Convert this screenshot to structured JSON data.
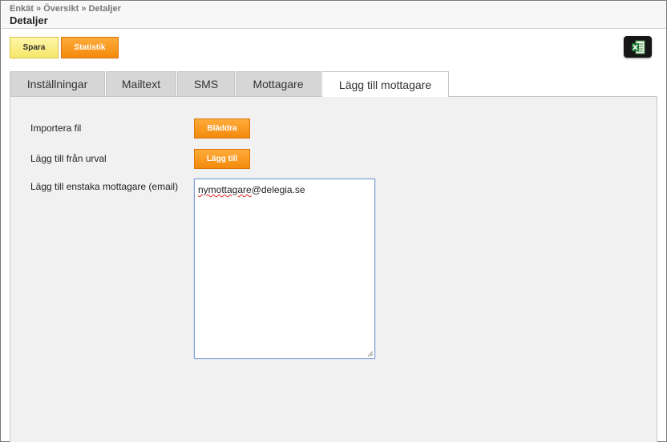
{
  "breadcrumb": {
    "items": [
      "Enkät",
      "Översikt",
      "Detaljer"
    ],
    "separator": "»"
  },
  "header": {
    "title": "Detaljer"
  },
  "toolbar": {
    "save_label": "Spara",
    "stats_label": "Statistik",
    "excel_icon": "excel-export-icon"
  },
  "tabs": [
    {
      "label": "Inställningar",
      "active": false
    },
    {
      "label": "Mailtext",
      "active": false
    },
    {
      "label": "SMS",
      "active": false
    },
    {
      "label": "Mottagare",
      "active": false
    },
    {
      "label": "Lägg till mottagare",
      "active": true
    }
  ],
  "form": {
    "import_label": "Importera fil",
    "browse_button": "Bläddra",
    "add_from_selection_label": "Lägg till från urval",
    "add_button": "Lägg till",
    "single_recipient_label": "Lägg till enstaka mottagare (email)",
    "email_value_main": "nymottagare",
    "email_value_domain": "@delegia",
    "email_value_tld": ".se"
  },
  "colors": {
    "accent_orange": "#f38a0c",
    "save_yellow": "#f6e66a",
    "panel_bg": "#f1f1f1",
    "tab_inactive": "#d6d6d6"
  }
}
